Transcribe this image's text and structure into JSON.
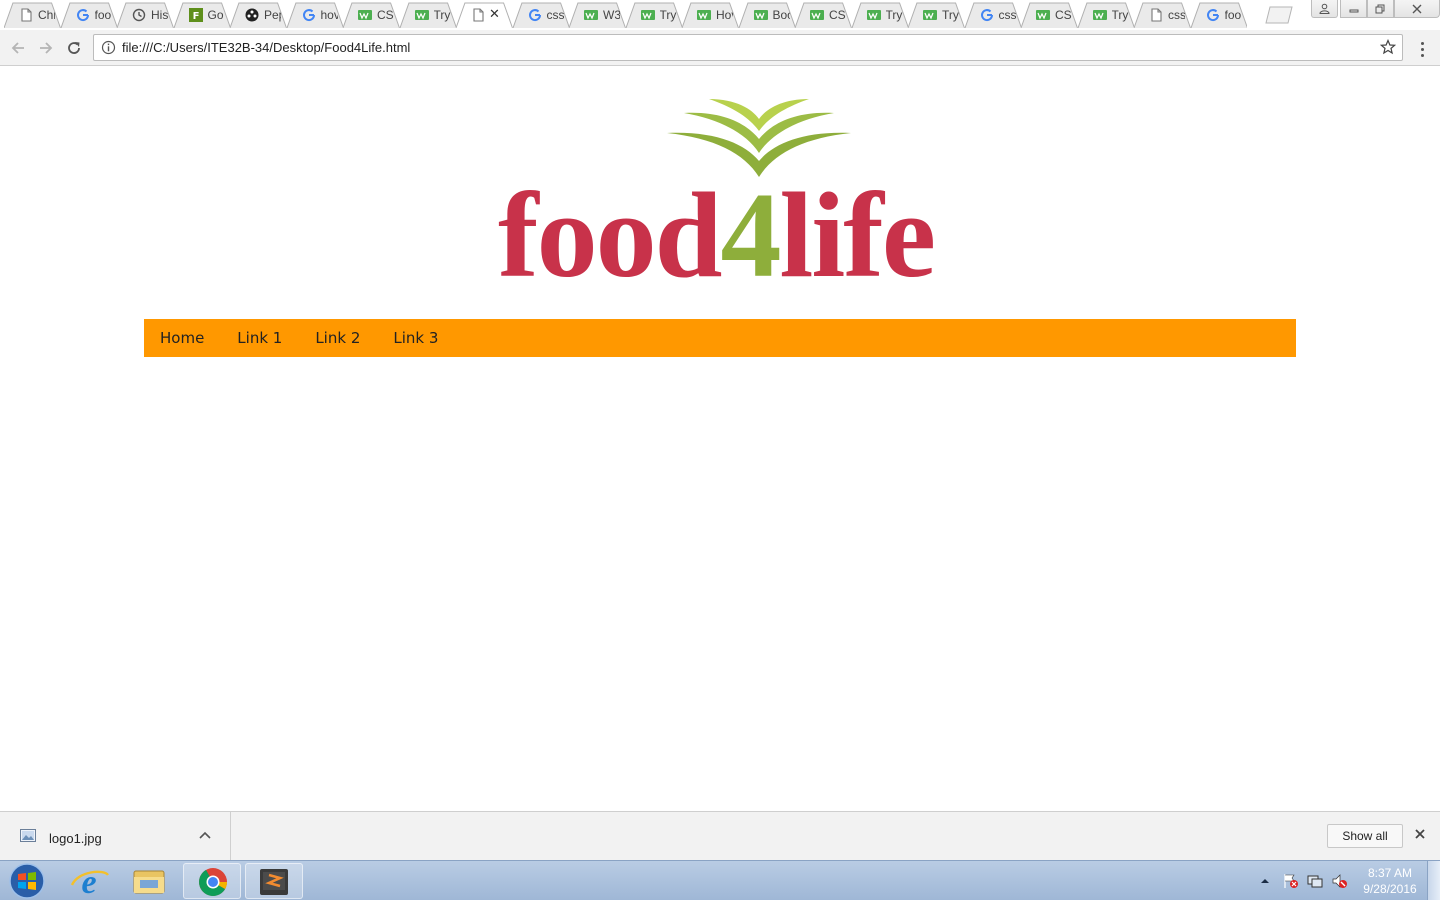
{
  "browser": {
    "tabs": [
      {
        "label": "Chr",
        "icon": "page-icon",
        "color": "#777777"
      },
      {
        "label": "foo",
        "icon": "google-icon",
        "color": "#4285f4"
      },
      {
        "label": "His",
        "icon": "history-icon",
        "color": "#555555"
      },
      {
        "label": "Go",
        "icon": "fl-icon",
        "color": "#5e8f1b"
      },
      {
        "label": "Pep",
        "icon": "film-icon",
        "color": "#222222"
      },
      {
        "label": "hov",
        "icon": "google-icon",
        "color": "#4285f4"
      },
      {
        "label": "CSS",
        "icon": "w3-icon",
        "color": "#4caf50"
      },
      {
        "label": "Try",
        "icon": "w3-icon",
        "color": "#4caf50"
      },
      {
        "label": "",
        "icon": "page-icon",
        "color": "#777777",
        "active": true
      },
      {
        "label": "css",
        "icon": "google-icon",
        "color": "#4285f4"
      },
      {
        "label": "W3",
        "icon": "w3-icon",
        "color": "#4caf50"
      },
      {
        "label": "Try",
        "icon": "w3-icon",
        "color": "#4caf50"
      },
      {
        "label": "Hov",
        "icon": "w3-icon",
        "color": "#4caf50"
      },
      {
        "label": "Boo",
        "icon": "w3-icon",
        "color": "#4caf50"
      },
      {
        "label": "CSS",
        "icon": "w3-icon",
        "color": "#4caf50"
      },
      {
        "label": "Try",
        "icon": "w3-icon",
        "color": "#4caf50"
      },
      {
        "label": "Try",
        "icon": "w3-icon",
        "color": "#4caf50"
      },
      {
        "label": "css",
        "icon": "google-icon",
        "color": "#4285f4"
      },
      {
        "label": "CSS",
        "icon": "w3-icon",
        "color": "#4caf50"
      },
      {
        "label": "Try",
        "icon": "w3-icon",
        "color": "#4caf50"
      },
      {
        "label": "css",
        "icon": "page-icon",
        "color": "#777777"
      },
      {
        "label": "foo",
        "icon": "google-icon",
        "color": "#4285f4"
      }
    ],
    "active_tab_close": "✕",
    "url": "file:///C:/Users/ITE32B-34/Desktop/Food4Life.html"
  },
  "page": {
    "logo": {
      "part1": "food",
      "part2": "4",
      "part3": "life",
      "red": "#c8324a",
      "green": "#8eae3b"
    },
    "nav": {
      "color": "#ff9800",
      "links": [
        "Home",
        "Link 1",
        "Link 2",
        "Link 3"
      ]
    }
  },
  "download_shelf": {
    "file_name": "logo1.jpg",
    "show_all_label": "Show all"
  },
  "taskbar": {
    "time": "8:37 AM",
    "date": "9/28/2016"
  }
}
